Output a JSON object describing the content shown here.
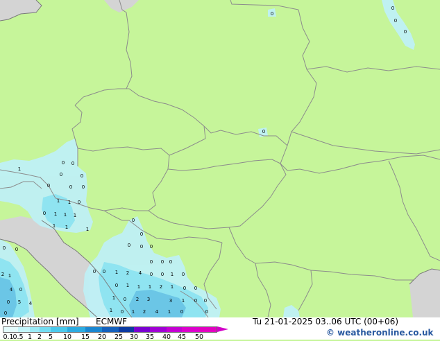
{
  "map": {
    "cell_values": [
      "0",
      "1",
      "2",
      "3",
      "4",
      "5",
      "8"
    ]
  },
  "footer": {
    "title_label": "Precipitation [mm]",
    "model_label": "ECMWF",
    "datetime_label": "Tu 21-01-2025 03..06 UTC (00+06)",
    "credit_label": "© weatheronline.co.uk"
  },
  "legend": {
    "ticks": [
      "0.1",
      "0.5",
      "1",
      "2",
      "5",
      "10",
      "15",
      "20",
      "25",
      "30",
      "35",
      "40",
      "45",
      "50"
    ],
    "colors": [
      "#e4fbfc",
      "#c2f4fa",
      "#9aeaf7",
      "#72dcf2",
      "#4ac8ec",
      "#2caae0",
      "#1a86d0",
      "#1460bc",
      "#0c3aa0",
      "#7a00d0",
      "#a000d4",
      "#c400d2",
      "#dc00cc",
      "#e200c0"
    ]
  },
  "colors": {
    "land": "#c6f59a",
    "sea": "#d4d4d4",
    "border": "#8c8c8c",
    "light_precip": "#bff0f5",
    "mid_precip": "#8fe4f1",
    "heavy_precip": "#6bc6e6"
  }
}
